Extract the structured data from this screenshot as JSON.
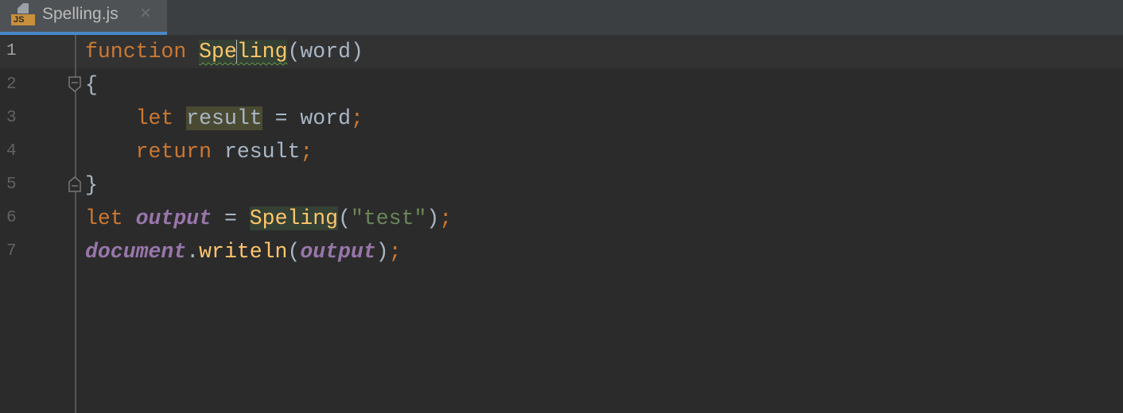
{
  "tab": {
    "title": "Spelling.js",
    "icon": "js-file-icon",
    "badge": "JS",
    "close_icon": "×"
  },
  "colors": {
    "background": "#2b2b2b",
    "keyword": "#cc7832",
    "function": "#ffc66d",
    "accent": "#4a88c7"
  },
  "editor": {
    "line_numbers": [
      "1",
      "2",
      "3",
      "4",
      "5",
      "6",
      "7"
    ],
    "current_line": 1,
    "lines": [
      [
        {
          "t": "function",
          "k": "keyword"
        },
        {
          "t": " ",
          "k": "plain"
        },
        {
          "t": "Spe",
          "k": "fn hl-fn typo"
        },
        {
          "t": "ling",
          "k": "fn hl-fn typo",
          "caret": true
        },
        {
          "t": "(word)",
          "k": "plain"
        }
      ],
      [
        {
          "t": "{",
          "k": "plain"
        }
      ],
      [
        {
          "t": "    ",
          "k": "plain"
        },
        {
          "t": "let",
          "k": "keyword"
        },
        {
          "t": " ",
          "k": "plain"
        },
        {
          "t": "result",
          "k": "plain hl-var"
        },
        {
          "t": " = word",
          "k": "plain"
        },
        {
          "t": ";",
          "k": "semi"
        }
      ],
      [
        {
          "t": "    ",
          "k": "plain"
        },
        {
          "t": "return",
          "k": "keyword"
        },
        {
          "t": " result",
          "k": "plain"
        },
        {
          "t": ";",
          "k": "semi"
        }
      ],
      [
        {
          "t": "}",
          "k": "plain"
        }
      ],
      [
        {
          "t": "let",
          "k": "keyword"
        },
        {
          "t": " ",
          "k": "plain"
        },
        {
          "t": "output",
          "k": "global"
        },
        {
          "t": " = ",
          "k": "plain"
        },
        {
          "t": "Speling",
          "k": "fn hl-fn"
        },
        {
          "t": "(",
          "k": "plain"
        },
        {
          "t": "\"test\"",
          "k": "str"
        },
        {
          "t": ")",
          "k": "plain"
        },
        {
          "t": ";",
          "k": "semi"
        }
      ],
      [
        {
          "t": "document",
          "k": "global"
        },
        {
          "t": ".",
          "k": "plain"
        },
        {
          "t": "writeln",
          "k": "fn"
        },
        {
          "t": "(",
          "k": "plain"
        },
        {
          "t": "output",
          "k": "global"
        },
        {
          "t": ")",
          "k": "plain"
        },
        {
          "t": ";",
          "k": "semi"
        }
      ]
    ]
  }
}
